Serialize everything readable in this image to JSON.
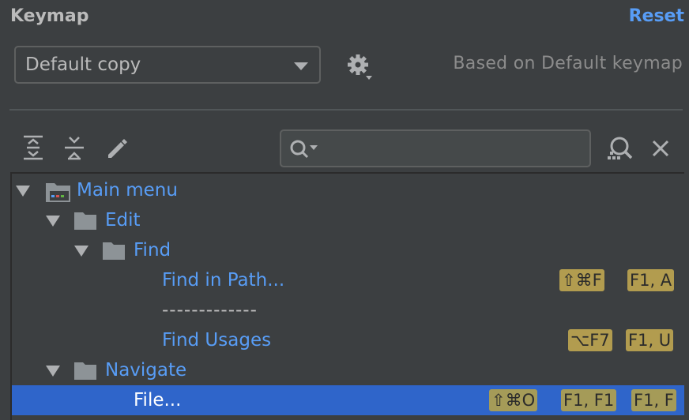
{
  "header": {
    "title": "Keymap",
    "reset_label": "Reset",
    "keymap_selected": "Default copy",
    "based_on": "Based on Default keymap"
  },
  "toolbar": {
    "icons": [
      "expand-all-icon",
      "collapse-all-icon",
      "edit-icon",
      "search-icon",
      "find-by-shortcut-icon",
      "clear-icon"
    ],
    "search_value": ""
  },
  "tree": {
    "main_menu": "Main menu",
    "edit": "Edit",
    "find": "Find",
    "find_in_path": "Find in Path...",
    "find_in_path_shortcuts": [
      "⇧⌘F",
      "F1, A"
    ],
    "separator": "-------------",
    "find_usages": "Find Usages",
    "find_usages_shortcuts": [
      "⌥F7",
      "F1, U"
    ],
    "navigate": "Navigate",
    "file": "File...",
    "file_shortcuts": [
      "⇧⌘O",
      "F1, F1",
      "F1, F"
    ]
  },
  "colors": {
    "background": "#3c3f41",
    "link": "#589df6",
    "selection": "#2f65ca",
    "shortcut_badge": "#b29c4f"
  }
}
